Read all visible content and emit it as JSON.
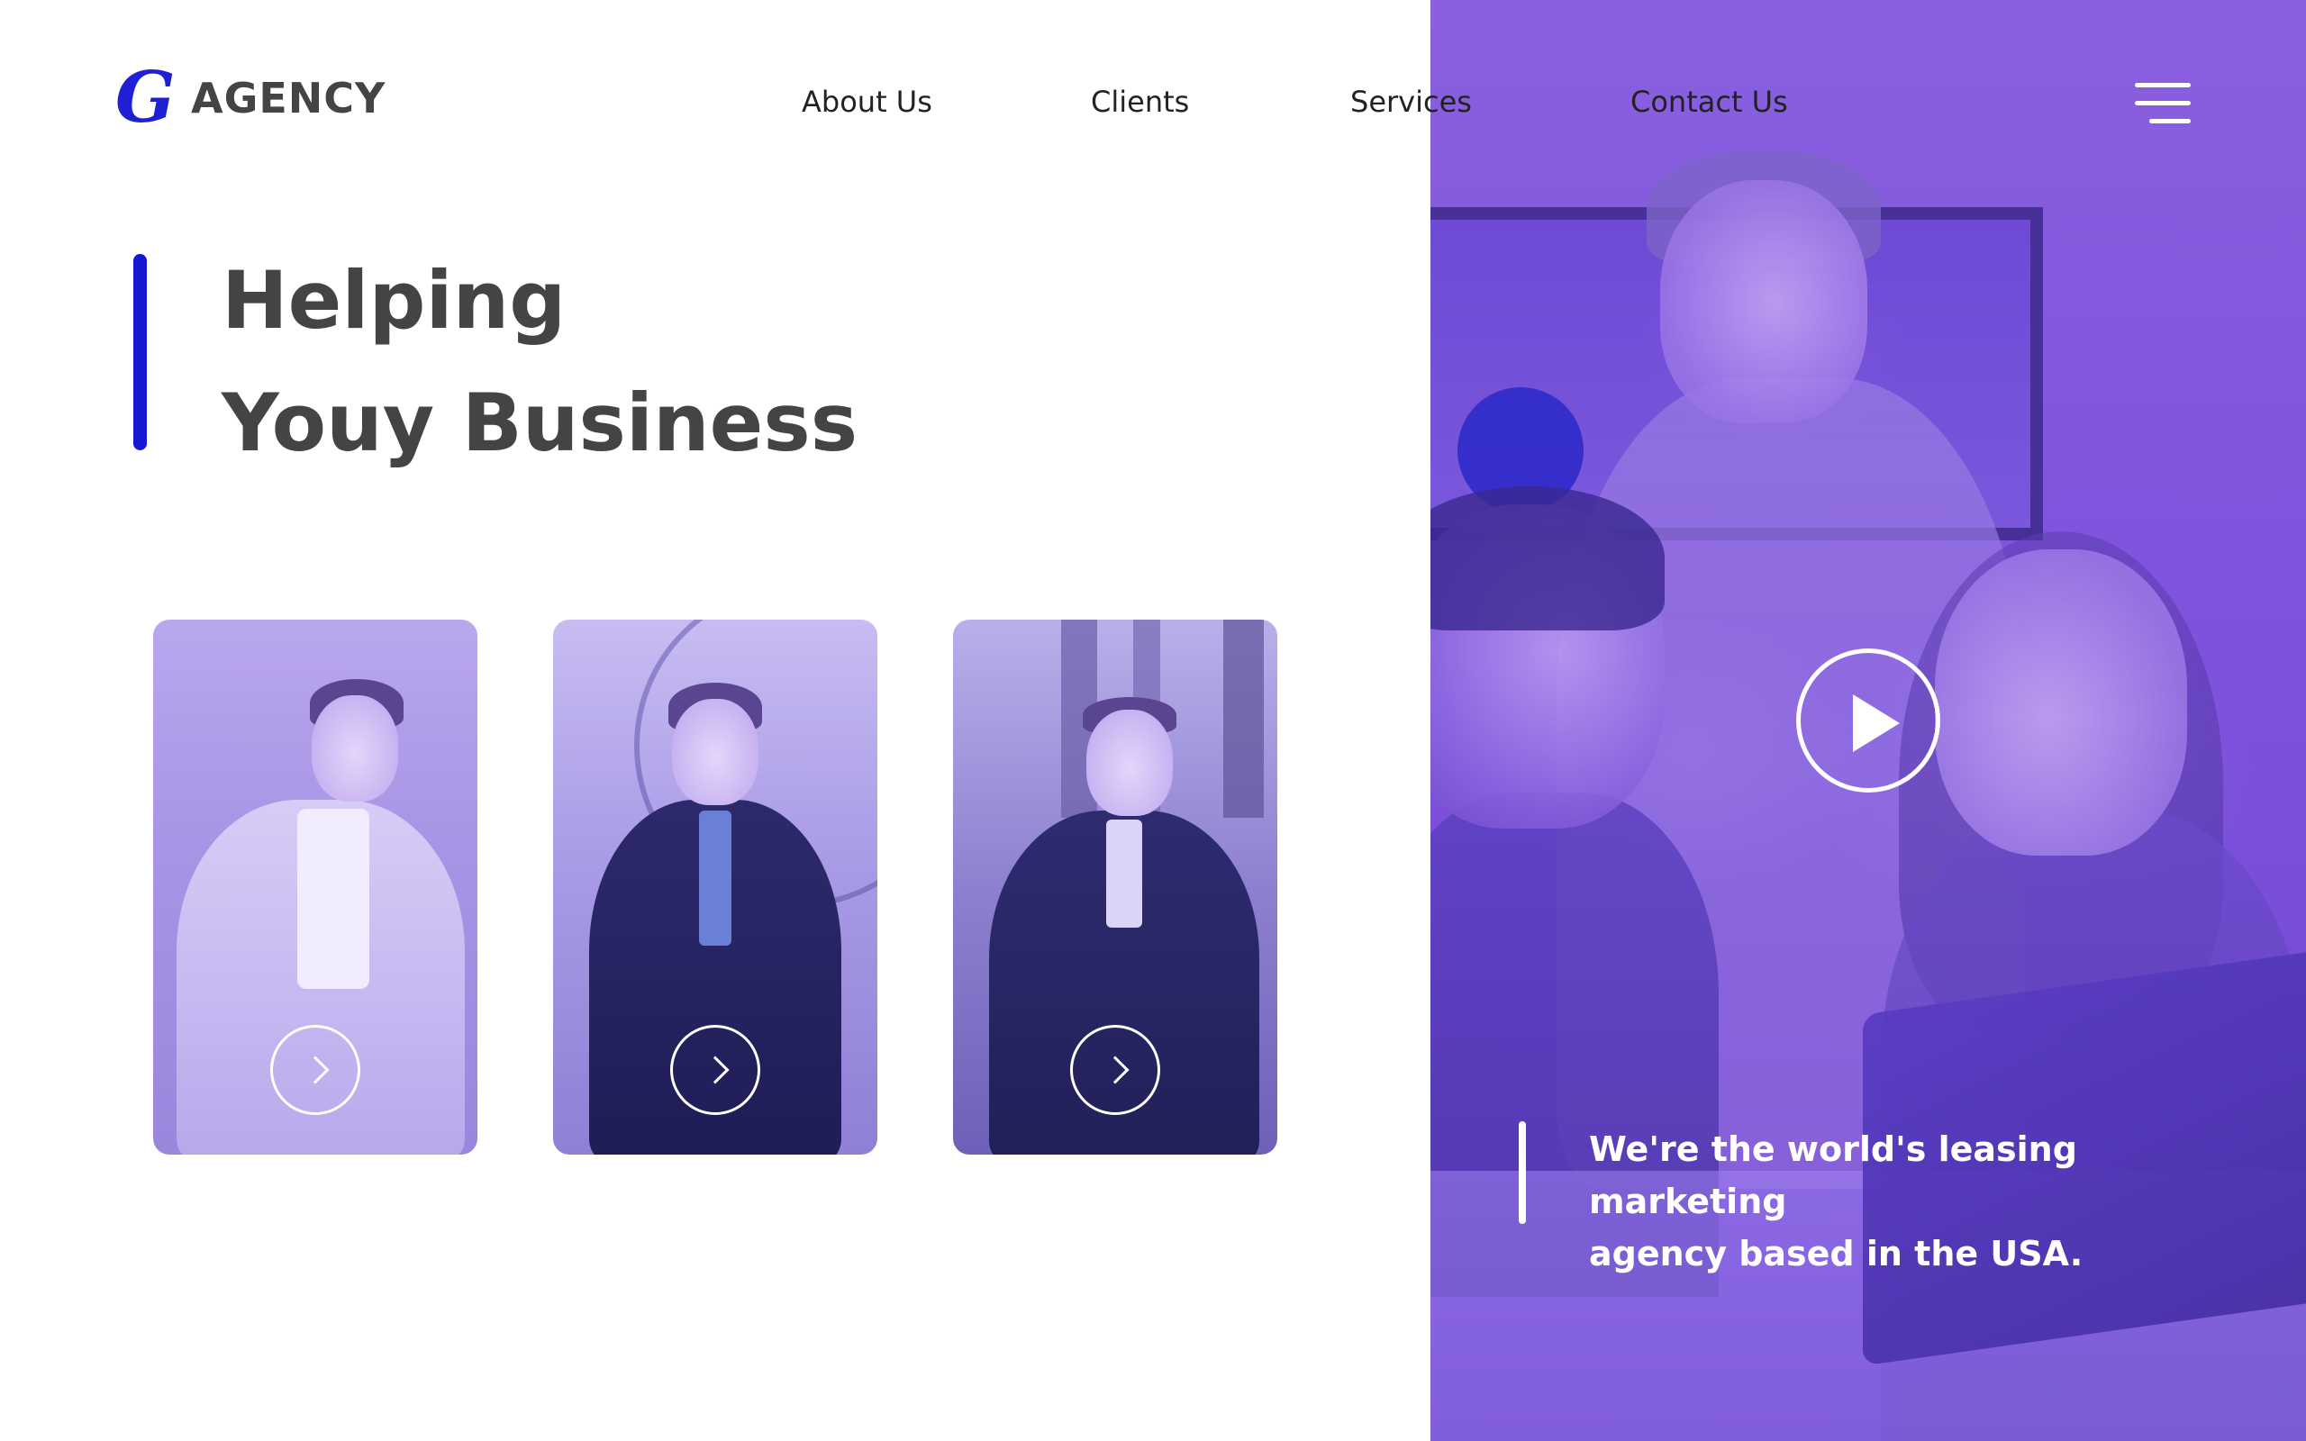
{
  "brand": {
    "logo_mark": "G",
    "name": "AGENCY",
    "accent_color": "#1418d2",
    "panel_color": "#7e52dc"
  },
  "nav": {
    "items": [
      {
        "label": "About Us"
      },
      {
        "label": "Clients"
      },
      {
        "label": "Services"
      },
      {
        "label": "Contact Us"
      }
    ],
    "menu_icon": "hamburger-menu-icon"
  },
  "hero": {
    "title_line1": "Helping",
    "title_line2": "Youy Business"
  },
  "cards": [
    {
      "icon": "chevron-right-icon"
    },
    {
      "icon": "chevron-right-icon"
    },
    {
      "icon": "chevron-right-icon"
    }
  ],
  "video": {
    "play_icon": "play-icon"
  },
  "tagline": {
    "text_line1": "We're the world's leasing marketing",
    "text_line2": "agency based in the USA."
  }
}
